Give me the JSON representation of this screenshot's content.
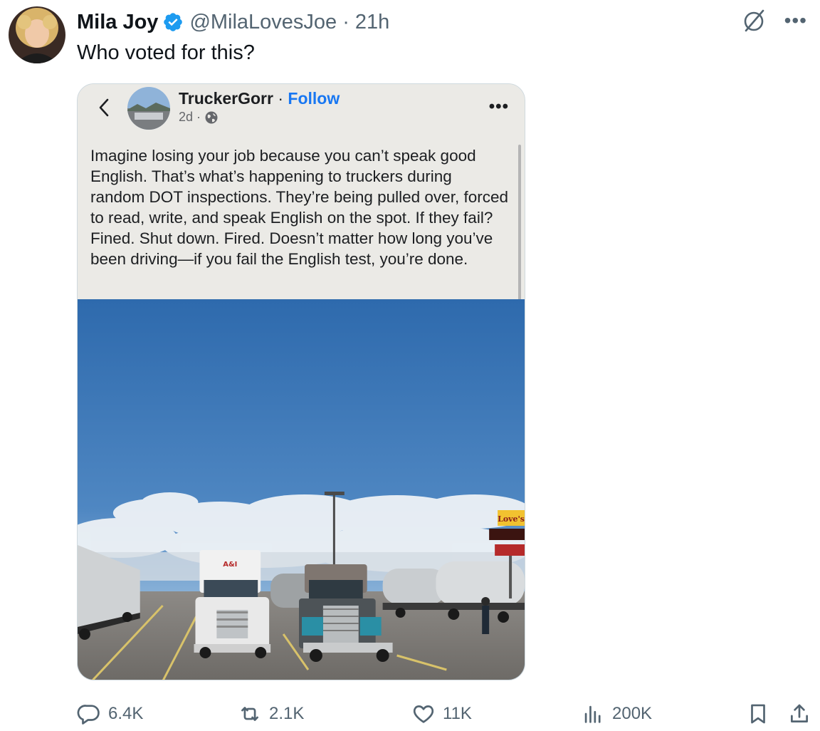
{
  "author": {
    "name": "Mila Joy",
    "handle": "@MilaLovesJoe",
    "separator": "·",
    "time": "21h"
  },
  "tweet": {
    "text": "Who voted for this?"
  },
  "embedded_screenshot": {
    "author_name": "TruckerGorr",
    "separator": "·",
    "follow_label": "Follow",
    "time": "2d",
    "meta_separator": "·",
    "body": "Imagine losing your job because you can’t speak good English. That’s what’s happening to truckers during random DOT inspections. They’re being pulled over, forced to read, write, and speak English on the spot. If they fail? Fined. Shut down. Fired. Doesn’t matter how long you’ve been driving—if you fail the English test, you’re done.",
    "photo_truck_label": "A&I",
    "photo_sign_label": "Love's"
  },
  "actions": {
    "replies": "6.4K",
    "reposts": "2.1K",
    "likes": "11K",
    "views": "200K"
  },
  "icons": {
    "verified": "verified-badge-icon",
    "grok": "grok-icon",
    "more": "more-icon",
    "reply": "reply-icon",
    "repost": "repost-icon",
    "like": "heart-icon",
    "views": "views-icon",
    "bookmark": "bookmark-icon",
    "share": "share-icon"
  },
  "colors": {
    "verified_blue": "#1d9bf0",
    "text_secondary": "#536471",
    "follow_blue": "#1877f2"
  }
}
